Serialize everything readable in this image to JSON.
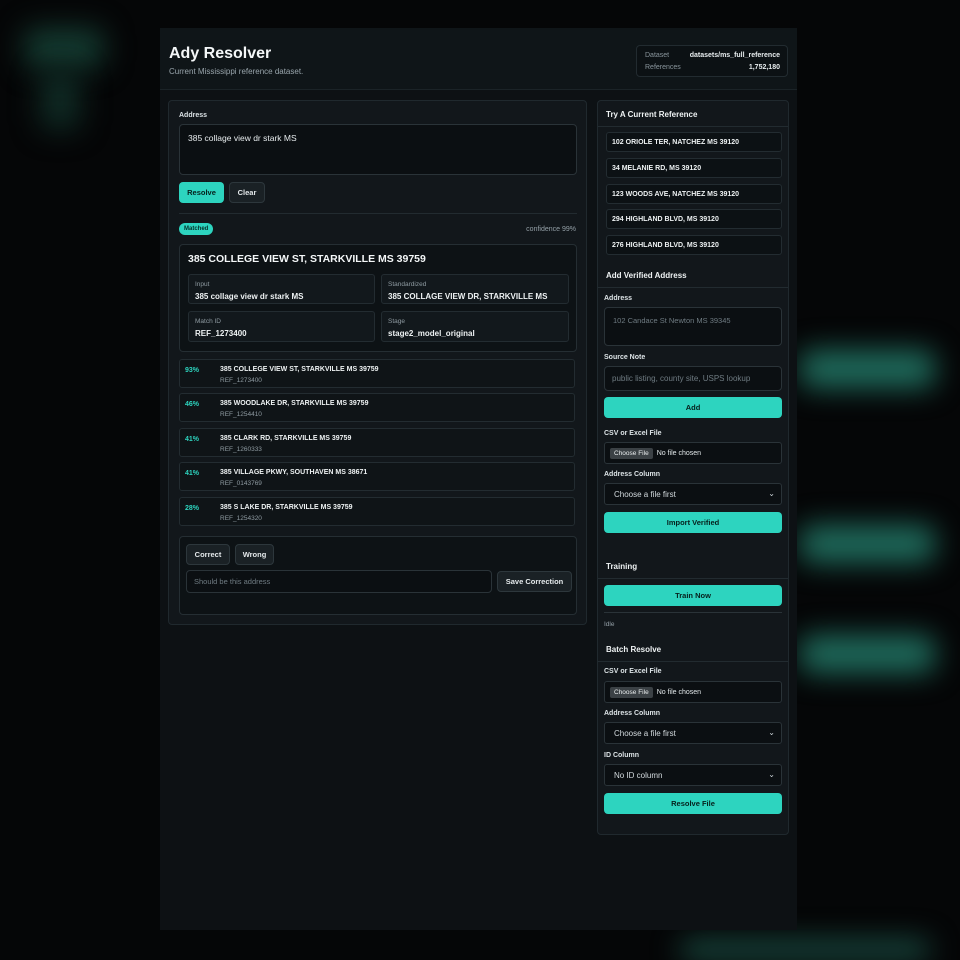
{
  "header": {
    "title": "Ady Resolver",
    "subtitle": "Current Mississippi reference dataset.",
    "dataset_label": "Dataset",
    "dataset_value": "datasets/ms_full_reference",
    "references_label": "References",
    "references_value": "1,752,180"
  },
  "resolve": {
    "address_label": "Address",
    "address_value": "385 collage view dr stark MS",
    "resolve_button": "Resolve",
    "clear_button": "Clear",
    "status_badge": "Matched",
    "confidence": "confidence 99%",
    "result_title": "385 COLLEGE VIEW ST, STARKVILLE MS 39759",
    "fields": [
      {
        "label": "Input",
        "value": "385 collage view dr stark MS"
      },
      {
        "label": "Standardized",
        "value": "385 COLLAGE VIEW DR, STARKVILLE MS"
      },
      {
        "label": "Match ID",
        "value": "REF_1273400"
      },
      {
        "label": "Stage",
        "value": "stage2_model_original"
      }
    ],
    "candidates": [
      {
        "pct": "93%",
        "address": "385 COLLEGE VIEW ST, STARKVILLE MS 39759",
        "ref": "REF_1273400"
      },
      {
        "pct": "46%",
        "address": "385 WOODLAKE DR, STARKVILLE MS 39759",
        "ref": "REF_1254410"
      },
      {
        "pct": "41%",
        "address": "385 CLARK RD, STARKVILLE MS 39759",
        "ref": "REF_1260333"
      },
      {
        "pct": "41%",
        "address": "385 VILLAGE PKWY, SOUTHAVEN MS 38671",
        "ref": "REF_0143769"
      },
      {
        "pct": "28%",
        "address": "385 S LAKE DR, STARKVILLE MS 39759",
        "ref": "REF_1254320"
      }
    ],
    "correct_button": "Correct",
    "wrong_button": "Wrong",
    "correction_placeholder": "Should be this address",
    "save_correction_button": "Save Correction"
  },
  "sidebar": {
    "try_title": "Try A Current Reference",
    "references": [
      "102 ORIOLE TER, NATCHEZ MS 39120",
      "34 MELANIE RD, MS 39120",
      "123 WOODS AVE, NATCHEZ MS 39120",
      "294 HIGHLAND BLVD, MS 39120",
      "276 HIGHLAND BLVD, MS 39120"
    ],
    "add_title": "Add Verified Address",
    "add_address_label": "Address",
    "add_address_placeholder": "102 Candace St Newton MS 39345",
    "source_note_label": "Source Note",
    "source_note_placeholder": "public listing, county site, USPS lookup",
    "add_button": "Add",
    "csv_label": "CSV or Excel File",
    "choose_file": "Choose File",
    "no_file": "No file chosen",
    "address_column_label": "Address Column",
    "address_column_value": "Choose a file first",
    "import_button": "Import Verified",
    "training_title": "Training",
    "train_button": "Train Now",
    "training_status": "Idle",
    "batch_title": "Batch Resolve",
    "batch_csv_label": "CSV or Excel File",
    "batch_address_column_label": "Address Column",
    "batch_address_column_value": "Choose a file first",
    "id_column_label": "ID Column",
    "id_column_value": "No ID column",
    "resolve_file_button": "Resolve File"
  },
  "colors": {
    "accent": "#2dd4bf",
    "background": "#050607",
    "panel": "#12171b"
  }
}
